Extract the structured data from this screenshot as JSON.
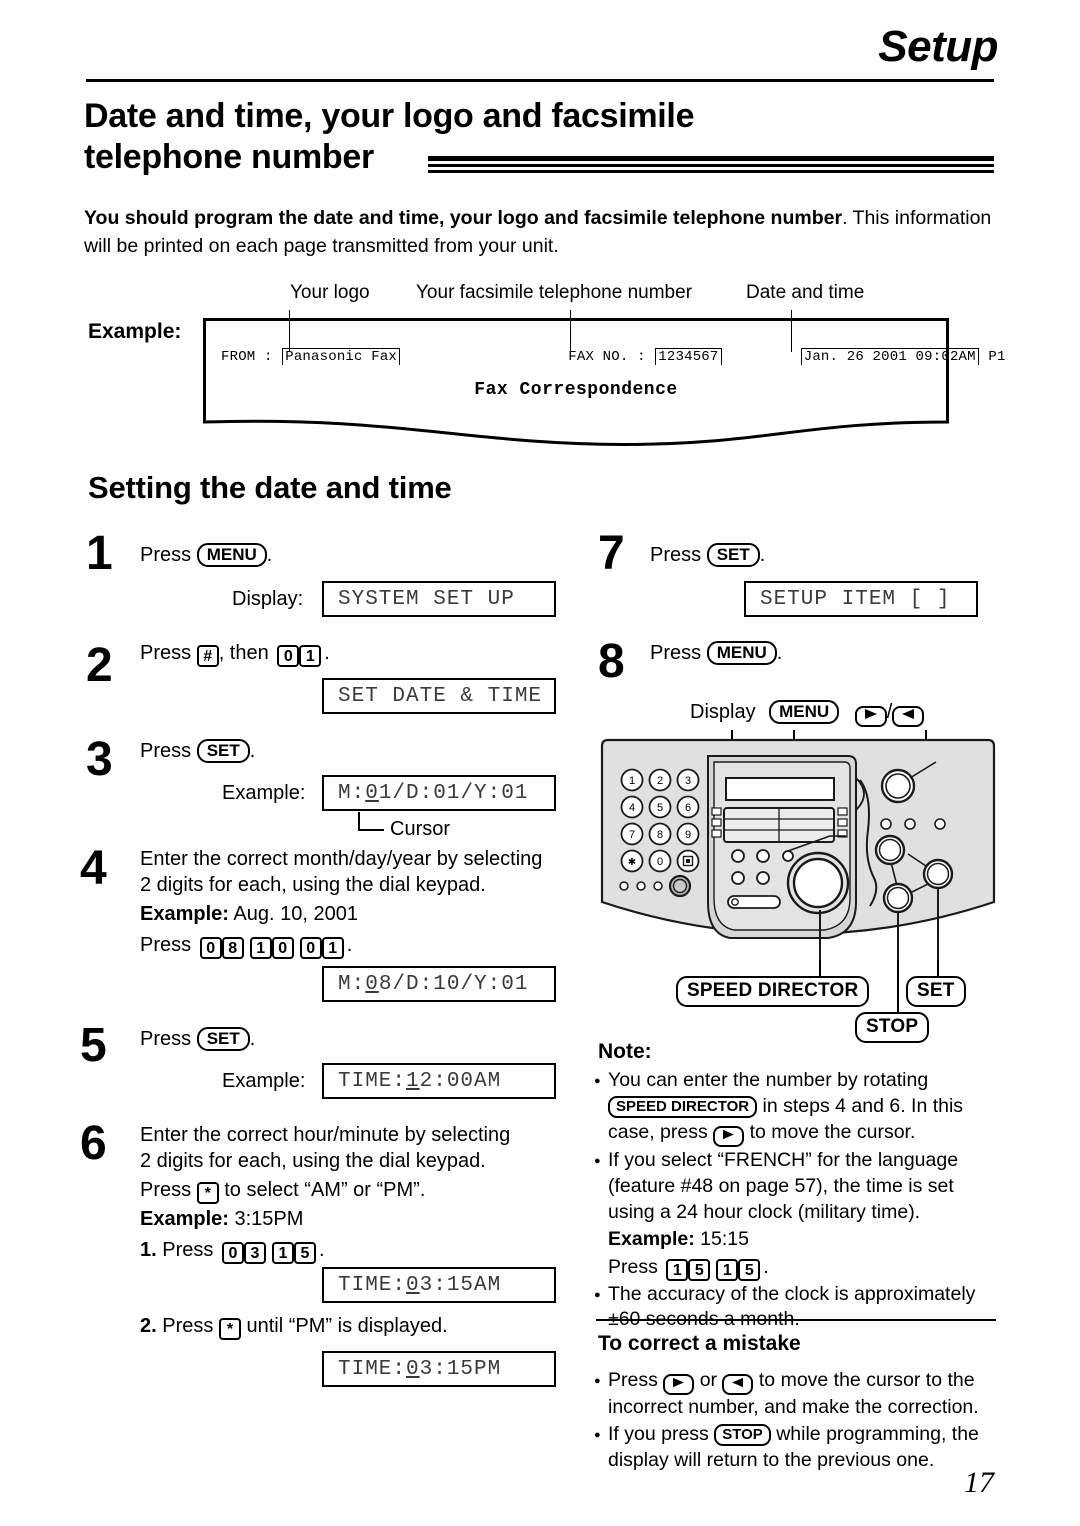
{
  "header": {
    "chapter": "Setup",
    "title_line1": "Date and time, your logo and facsimile",
    "title_line2": "telephone number"
  },
  "intro": {
    "bold_part": "You should program the date and time, your logo and facsimile telephone number",
    "rest": ". This information will be printed on each page transmitted from your unit."
  },
  "example": {
    "label": "Example:",
    "callout_logo": "Your logo",
    "callout_fax": "Your facsimile telephone number",
    "callout_date": "Date and time",
    "from_prefix": "FROM :",
    "from_value": "Panasonic Fax",
    "faxno_prefix": "FAX NO. :",
    "faxno_value": "1234567",
    "datetime_value": "Jan. 26 2001 09:02AM",
    "page_mark": "P1",
    "body_title": "Fax Correspondence"
  },
  "section": {
    "heading": "Setting the date and time"
  },
  "steps": {
    "s1": {
      "num": "1",
      "press": "Press",
      "key": "MENU",
      "period": ".",
      "display_label": "Display:",
      "lcd": "SYSTEM SET UP"
    },
    "s2": {
      "num": "2",
      "press": "Press",
      "hash_key": "#",
      "then": ", then",
      "d1": "0",
      "d2": "1",
      "period": ".",
      "lcd": "SET DATE & TIME"
    },
    "s3": {
      "num": "3",
      "press": "Press",
      "key": "SET",
      "period": ".",
      "example_label": "Example:",
      "lcd_pre": "M:",
      "lcd_cursor": "0",
      "lcd_post": "1/D:01/Y:01",
      "cursor_label": "Cursor"
    },
    "s4": {
      "num": "4",
      "line1": "Enter the correct month/day/year by selecting",
      "line2": "2 digits for each, using the dial keypad.",
      "example_label": "Example:",
      "example_value": "Aug. 10, 2001",
      "press": "Press",
      "keys": [
        "0",
        "8",
        "1",
        "0",
        "0",
        "1"
      ],
      "period": ".",
      "lcd_pre": "M:",
      "lcd_cursor": "0",
      "lcd_post": "8/D:10/Y:01"
    },
    "s5": {
      "num": "5",
      "press": "Press",
      "key": "SET",
      "period": ".",
      "example_label": "Example:",
      "lcd_pre": "TIME:   ",
      "lcd_cursor": "1",
      "lcd_post": "2:00AM"
    },
    "s6": {
      "num": "6",
      "line1": "Enter the correct hour/minute by selecting",
      "line2": "2 digits for each, using the dial keypad.",
      "press_star_pre": "Press",
      "star_key": "*",
      "press_star_post": "to select “AM” or “PM”.",
      "example_label": "Example:",
      "example_value": "3:15PM",
      "sub1_num": "1.",
      "sub1_press": "Press",
      "sub1_keys": [
        "0",
        "3",
        "1",
        "5"
      ],
      "sub1_period": ".",
      "lcd1_pre": "TIME:   ",
      "lcd1_cursor": "0",
      "lcd1_post": "3:15AM",
      "sub2_num": "2.",
      "sub2_press": "Press",
      "sub2_star": "*",
      "sub2_post": "until “PM” is displayed.",
      "lcd2_pre": "TIME:   ",
      "lcd2_cursor": "0",
      "lcd2_post": "3:15PM"
    },
    "s7": {
      "num": "7",
      "press": "Press",
      "key": "SET",
      "period": ".",
      "lcd": "SETUP ITEM [  ]"
    },
    "s8": {
      "num": "8",
      "press": "Press",
      "key": "MENU",
      "period": "."
    }
  },
  "device": {
    "label_display": "Display",
    "label_menu": "MENU",
    "label_slash": "/",
    "tag_speed_director": "SPEED DIRECTOR",
    "tag_set": "SET",
    "tag_stop": "STOP",
    "keypad": [
      "1",
      "2",
      "3",
      "4",
      "5",
      "6",
      "7",
      "8",
      "9",
      "✱",
      "0",
      "▣"
    ],
    "panel_color": "#e0e0e0",
    "panel_shadow": "#c9c9c9"
  },
  "note": {
    "heading": "Note:",
    "item1_a": "You can enter the number by rotating",
    "item1_key": "SPEED DIRECTOR",
    "item1_b": "in steps 4 and 6. In this case, press",
    "item1_c": "to move the cursor.",
    "item2_a": "If you select “FRENCH” for the language (feature #48 on page 57), the time is set using a 24 hour clock (military time).",
    "item2_example_label": "Example:",
    "item2_example_value": "15:15",
    "item2_press": "Press",
    "item2_keys": [
      "1",
      "5",
      "1",
      "5"
    ],
    "item2_period": ".",
    "item3": "The accuracy of the clock is approximately ±60 seconds a month."
  },
  "correct": {
    "heading": "To correct a mistake",
    "item1_a": "Press",
    "item1_or": "or",
    "item1_b": "to move the cursor to the incorrect number, and make the correction.",
    "item2_a": "If you press",
    "item2_key": "STOP",
    "item2_b": "while programming, the display will return to the previous one."
  },
  "footer": {
    "page_number": "17"
  }
}
